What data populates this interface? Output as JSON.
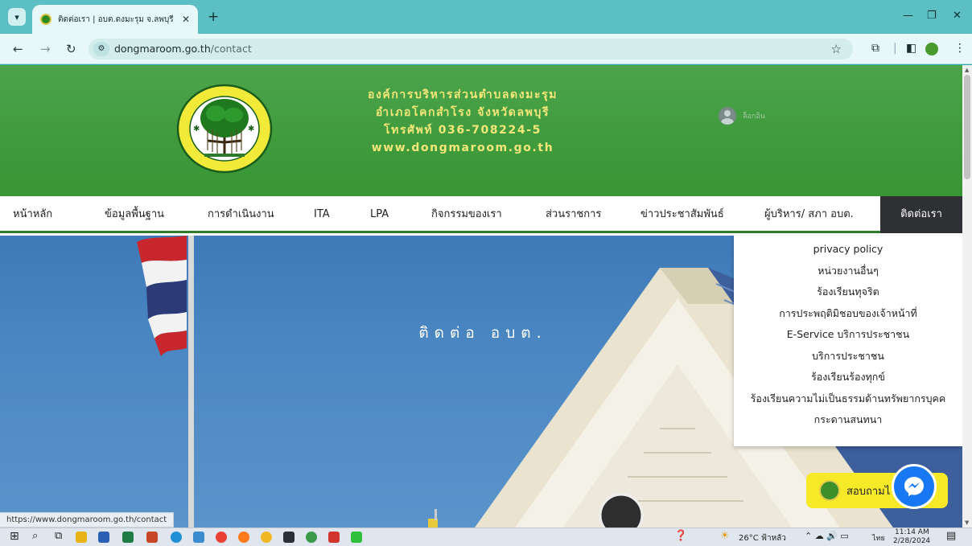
{
  "browser": {
    "tab_title": "ติดต่อเรา | อบต.ดงมะรุม จ.ลพบุรี",
    "url_domain": "dongmaroom.go.th",
    "url_path": "/contact"
  },
  "header": {
    "org_lines": [
      "องค์การบริหารส่วนตำบลดงมะรุม",
      "อำเภอโคกสำโรง  จังหวัดลพบุรี",
      "โทรศัพท์ 036-708224-5",
      "www.dongmaroom.go.th"
    ],
    "login_label": "ล็อกอิน"
  },
  "nav": [
    "หน้าหลัก",
    "ข้อมูลพื้นฐาน",
    "การดำเนินงาน",
    "ITA",
    "LPA",
    "กิจกรรมของเรา",
    "ส่วนราชการ",
    "ข่าวประชาสัมพันธ์",
    "ผู้บริหาร/ สภา อบต.",
    "ติดต่อเรา"
  ],
  "hero": {
    "title": "ติดต่อ อบต."
  },
  "dropdown": [
    "privacy policy",
    "หน่วยงานอื่นๆ",
    "ร้องเรียนทุจริต",
    "การประพฤติมิชอบของเจ้าหน้าที่",
    "E-Service บริการประชาชน",
    "บริการประชาชน",
    "ร้องเรียนร้องทุกข์",
    "ร้องเรียนความไม่เป็นธรรมด้านทรัพยากรบุคค",
    "กระดานสนทนา"
  ],
  "chat": {
    "label": "สอบถามไ"
  },
  "status_url": "https://www.dongmaroom.go.th/contact",
  "taskbar": {
    "weather": "26°C ฟ้าหลัว",
    "lang": "ไทย",
    "time": "11:14 AM",
    "date": "2/28/2024"
  },
  "colors": {
    "header_green": "#3f9a3c",
    "org_text": "#f3e77a",
    "nav_active_bg": "#2f3033",
    "chat_yellow": "#f5e928",
    "messenger_blue": "#1877f2"
  }
}
